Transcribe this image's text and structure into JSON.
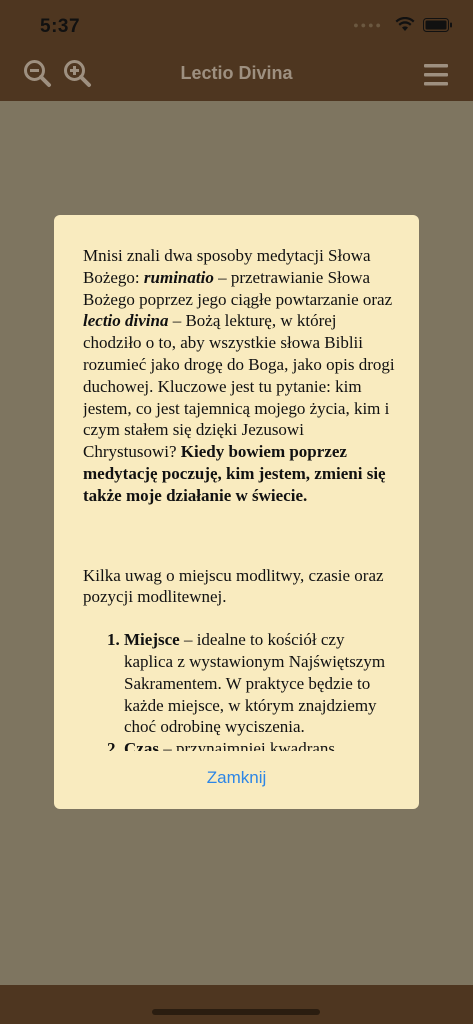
{
  "status": {
    "time": "5:37"
  },
  "nav": {
    "title": "Lectio Divina"
  },
  "dialog": {
    "para1": {
      "t1": "Mnisi znali dwa sposoby medytacji Słowa Bożego: ",
      "b1": "ruminatio",
      "t2": " – przetrawianie Słowa Bożego poprzez jego ciągłe powtarzanie oraz ",
      "b2": "lectio divina",
      "t3": " – Bożą lekturę, w której chodziło o to, aby wszystkie słowa Biblii rozumieć jako drogę do Boga, jako opis drogi duchowej. Kluczowe jest tu pytanie: kim jestem, co jest tajemnicą mojego życia, kim i czym stałem się dzięki Jezusowi Chrystusowi? ",
      "b3": "Kiedy bowiem poprzez medytację poczuję, kim jestem, zmieni się także moje działanie w świecie."
    },
    "para2": "Kilka uwag o miejscu modlitwy, czasie oraz pozycji modlitewnej.",
    "list": [
      {
        "term": "Miejsce",
        "text": " – idealne to kościół czy kaplica z wystawionym Najświętszym Sakramentem. W praktyce będzie to każde miejsce, w którym znajdziemy choć odrobinę wyciszenia."
      },
      {
        "term": "Czas",
        "text": " – przynajmniej kwadrans."
      }
    ],
    "close_label": "Zamknij"
  }
}
